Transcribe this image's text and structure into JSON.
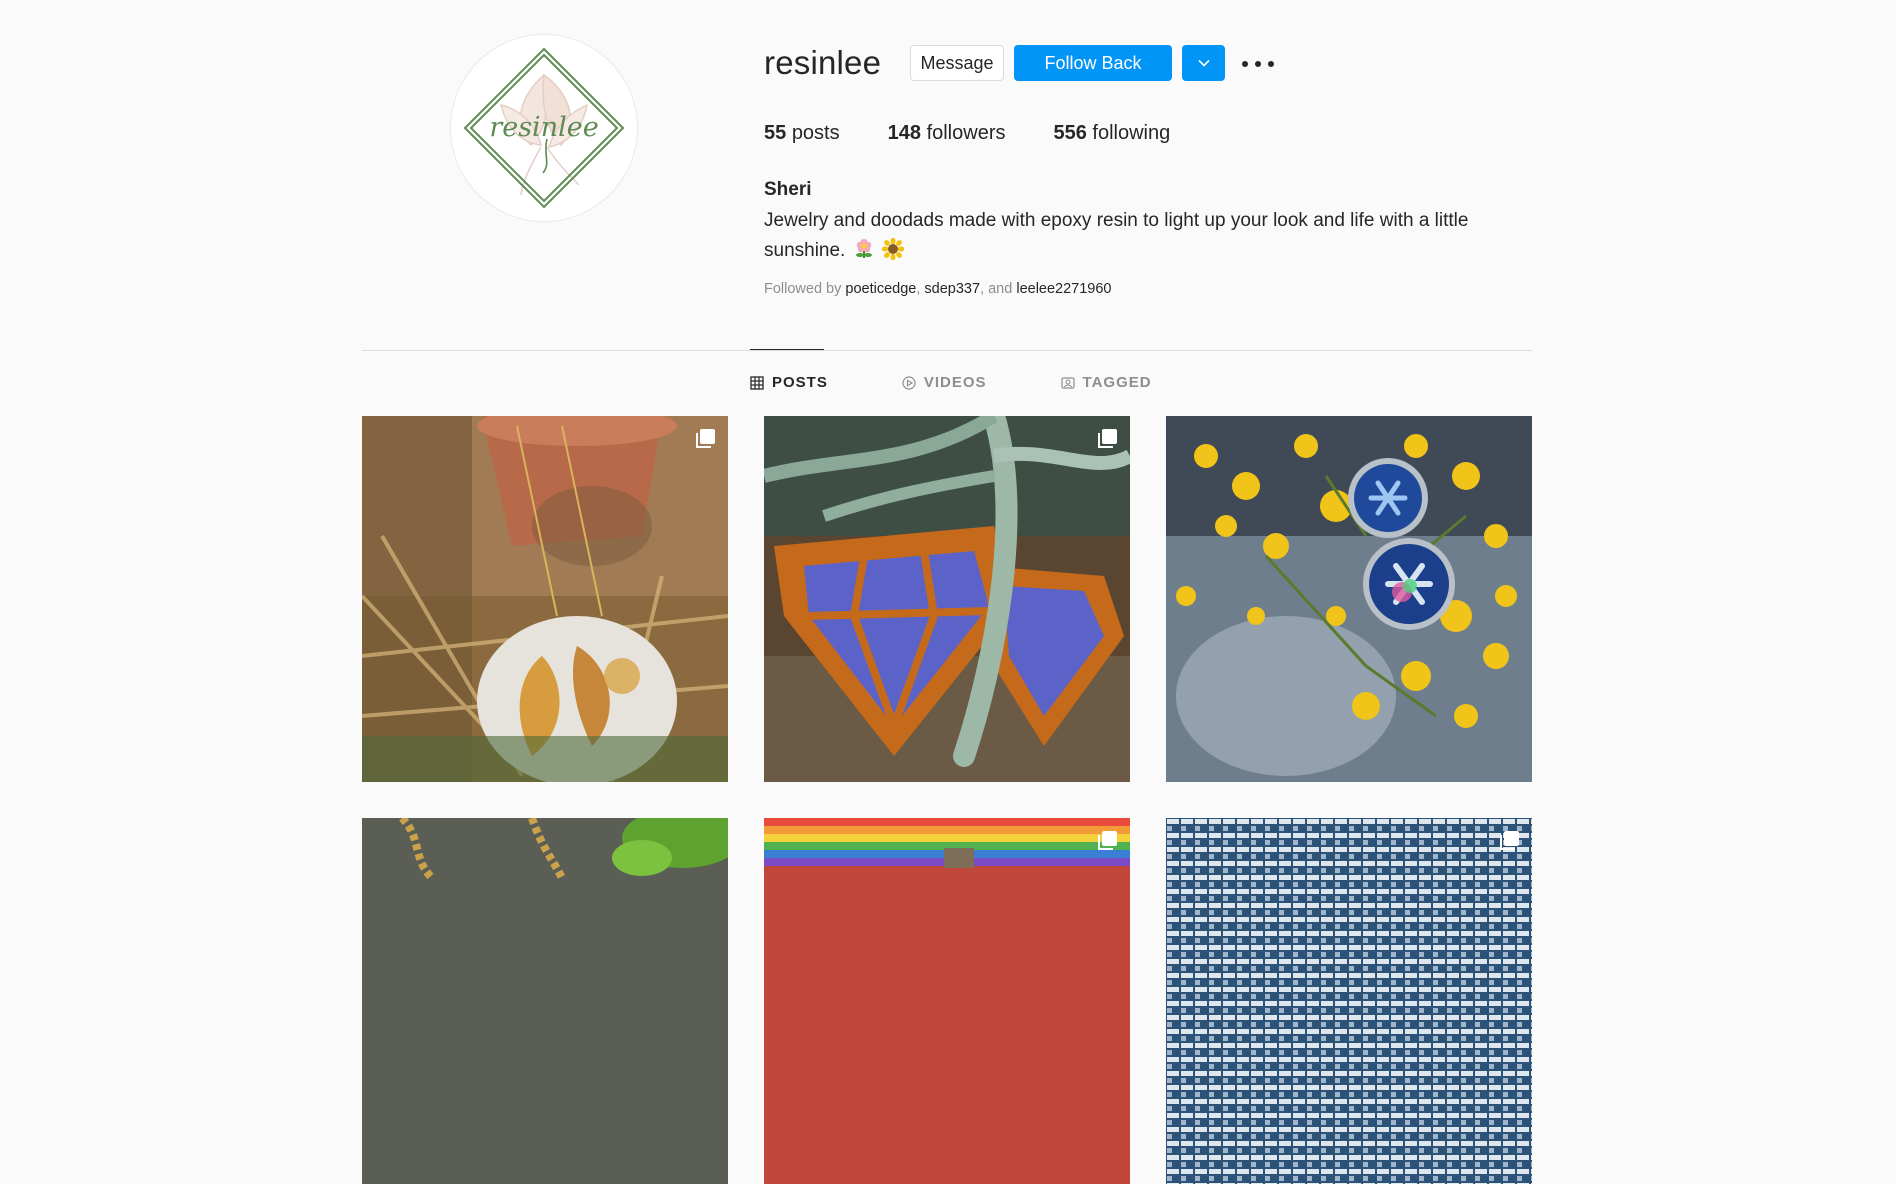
{
  "profile": {
    "username": "resinlee",
    "avatar_text": "resinlee",
    "message_label": "Message",
    "follow_label": "Follow Back",
    "posts_count": "55",
    "posts_label": "posts",
    "followers_count": "148",
    "followers_label": "followers",
    "following_count": "556",
    "following_label": "following",
    "full_name": "Sheri",
    "bio": "Jewelry and doodads made with epoxy resin to light up your look and life with a little sunshine.",
    "bio_emojis": [
      "flower-emoji",
      "sunflower-emoji"
    ],
    "followed_by_prefix": "Followed by",
    "followed_by": [
      "poeticedge",
      "sdep337",
      "leelee2271960"
    ],
    "followed_by_sep1": ", ",
    "followed_by_sep2": ", and "
  },
  "tabs": [
    {
      "label": "POSTS",
      "icon": "grid-icon",
      "active": true
    },
    {
      "label": "VIDEOS",
      "icon": "play-icon",
      "active": false
    },
    {
      "label": "TAGGED",
      "icon": "tag-icon",
      "active": false
    }
  ],
  "posts": [
    {
      "subject": "pressed-flower resin pendant",
      "multi": true
    },
    {
      "subject": "wooden diamond earrings",
      "multi": true
    },
    {
      "subject": "blue snowflake stud earrings",
      "multi": false
    },
    {
      "subject": "gold chain with leaves",
      "multi": false
    },
    {
      "subject": "rainbow stripes",
      "multi": true
    },
    {
      "subject": "blue woven pattern",
      "multi": true
    }
  ],
  "colors": {
    "accent": "#0095f6",
    "text": "#262626",
    "muted": "#8e8e8e",
    "background": "#fafafa",
    "avatar_green": "#5e8a54"
  }
}
